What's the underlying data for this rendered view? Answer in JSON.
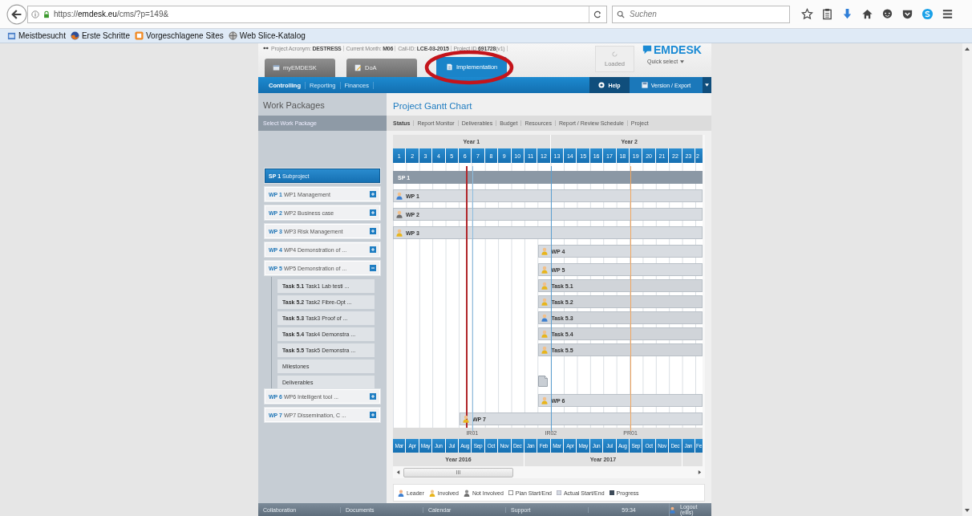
{
  "browser": {
    "url": "https://**emdesk.eu**/cms/?p=149&",
    "search": {
      "placeholder": "Suchen"
    },
    "bookmarks": [
      {
        "label": "Meistbesucht",
        "kind": "folder"
      },
      {
        "label": "Erste Schritte",
        "kind": "firefox"
      },
      {
        "label": "Vorgeschlagene Sites",
        "kind": "sites"
      },
      {
        "label": "Web Slice-Katalog",
        "kind": "globe"
      }
    ]
  },
  "header": {
    "info": [
      "Project Acronym: **DESTRESS**",
      "Current Month: **M06**",
      "Call-ID: **LCE-03-2015**",
      "Project ID **691728**(v1)"
    ],
    "tabs": [
      {
        "label": "myEMDESK",
        "selected": false,
        "kind": "home"
      },
      {
        "label": "DoA",
        "selected": false,
        "kind": "edit"
      },
      {
        "label": "Implementation",
        "selected": true,
        "kind": "doc"
      }
    ],
    "loaded": {
      "label": "Loaded",
      "disabled": true
    },
    "logo": "EMDESK",
    "quick_select": "Quick select"
  },
  "nav": {
    "items": [
      {
        "label": "Controlling",
        "selected": true
      },
      {
        "label": "Reporting",
        "selected": false
      },
      {
        "label": "Finances",
        "selected": false
      }
    ],
    "help": "Help",
    "export": "Version / Export"
  },
  "sidebar": {
    "title": "Work Packages",
    "subtitle": "Select Work Package",
    "items": [
      {
        "kind": "sp",
        "code": "SP 1",
        "title": "Subproject",
        "selected": true
      },
      {
        "kind": "wp",
        "code": "WP 1",
        "title": "WP1 Management",
        "selected": false,
        "expanded": false
      },
      {
        "kind": "wp",
        "code": "WP 2",
        "title": "WP2 Business case",
        "selected": false,
        "expanded": false
      },
      {
        "kind": "wp",
        "code": "WP 3",
        "title": "WP3 Risk Management",
        "selected": false,
        "expanded": false
      },
      {
        "kind": "wp",
        "code": "WP 4",
        "title": "WP4 Demonstration of ...",
        "selected": false,
        "expanded": false
      },
      {
        "kind": "wp",
        "code": "WP 5",
        "title": "WP5 Demonstration of ...",
        "selected": false,
        "expanded": true,
        "children": [
          {
            "code": "Task 5.1",
            "title": "Task1 Lab testi ..."
          },
          {
            "code": "Task 5.2",
            "title": "Task2 Fibre-Opt ..."
          },
          {
            "code": "Task 5.3",
            "title": "Task3 Proof of ..."
          },
          {
            "code": "Task 5.4",
            "title": "Task4 Demonstra ..."
          },
          {
            "code": "Task 5.5",
            "title": "Task5 Demonstra ..."
          },
          {
            "title": "Milestones"
          },
          {
            "title": "Deliverables"
          }
        ]
      },
      {
        "kind": "wp",
        "code": "WP 6",
        "title": "WP6 Intelligent tool ...",
        "selected": false,
        "expanded": false
      },
      {
        "kind": "wp",
        "code": "WP 7",
        "title": "WP7 Dissemination, C ...",
        "selected": false,
        "expanded": false
      }
    ]
  },
  "main": {
    "title": "Project Gantt Chart",
    "tabs": [
      {
        "label": "Status",
        "selected": true
      },
      {
        "label": "Report Monitor",
        "selected": false
      },
      {
        "label": "Deliverables",
        "selected": false
      },
      {
        "label": "Budget",
        "selected": false
      },
      {
        "label": "Resources",
        "selected": false
      },
      {
        "label": "Report / Review Schedule",
        "selected": false
      },
      {
        "label": "Project",
        "selected": false
      }
    ]
  },
  "gantt": {
    "top_years": [
      {
        "label": "Year 1",
        "months": [
          "1",
          "2",
          "3",
          "4",
          "5",
          "6",
          "7",
          "8",
          "9",
          "10",
          "11",
          "12"
        ]
      },
      {
        "label": "Year 2",
        "months": [
          "13",
          "14",
          "15",
          "16",
          "17",
          "18",
          "19",
          "20",
          "21",
          "22",
          "23",
          "2"
        ]
      }
    ],
    "rows": [
      {
        "kind": "summary",
        "label": "SP 1",
        "level": 1
      },
      {
        "kind": "wp",
        "label": "WP 1",
        "color": "#3d7fcf",
        "level": 1
      },
      {
        "kind": "wp",
        "label": "WP 2",
        "color": "#6e6e6e",
        "level": 1
      },
      {
        "kind": "wp",
        "label": "WP 3",
        "color": "#e8b51c",
        "level": 1
      },
      {
        "kind": "wp",
        "label": "WP 4",
        "color": "#e8b51c",
        "level": 0.53
      },
      {
        "kind": "wp",
        "label": "WP 5",
        "color": "#e8b51c",
        "level": 0.53
      },
      {
        "kind": "task",
        "label": "Task 5.1",
        "color": "#e8b51c",
        "level": 0.53
      },
      {
        "kind": "task",
        "label": "Task 5.2",
        "color": "#e8b51c",
        "level": 0.53
      },
      {
        "kind": "task",
        "label": "Task 5.3",
        "color": "#3d7fcf",
        "level": 0.53
      },
      {
        "kind": "task",
        "label": "Task 5.4",
        "color": "#e8b51c",
        "level": 0.53
      },
      {
        "kind": "task",
        "label": "Task 5.5",
        "color": "#e8b51c",
        "level": 0.53
      },
      {
        "kind": "deliverable",
        "level": 0.53
      },
      {
        "kind": "wp",
        "label": "WP 6",
        "color": "#e8b51c",
        "level": 0.53
      },
      {
        "kind": "wp",
        "label": "WP 7",
        "color": "#e8b51c",
        "level": 0.785
      }
    ],
    "markers": [
      {
        "kind": "today",
        "color": "#b0262b",
        "level": 0.236
      },
      {
        "kind": "milestone",
        "label": "IR01",
        "color": "#8dbde0",
        "level": 0.256
      },
      {
        "kind": "milestone",
        "label": "IR02",
        "color": "#5c9fd0",
        "level": 0.51
      },
      {
        "kind": "milestone",
        "label": "PR01",
        "color": "#f2a65e",
        "level": 0.767
      }
    ],
    "bottom_years": [
      {
        "label": "Year 2016",
        "months": [
          "Mar",
          "Apr",
          "May",
          "Jun",
          "Jul",
          "Aug",
          "Sep",
          "Oct",
          "Nov",
          "Dec"
        ]
      },
      {
        "label": "Year 2017",
        "months": [
          "Jan",
          "Feb",
          "Mar",
          "Apr",
          "May",
          "Jun",
          "Jul",
          "Aug",
          "Sep",
          "Oct",
          "Nov",
          "Dec"
        ]
      },
      {
        "months": [
          "Jan",
          "Fe"
        ]
      }
    ],
    "scroll_thumb": "III"
  },
  "legend": [
    {
      "kind": "leader",
      "label": "Leader"
    },
    {
      "kind": "involved",
      "label": "Involved"
    },
    {
      "kind": "not_involved",
      "label": "Not Involved"
    },
    {
      "kind": "plan",
      "label": "Plan Start/End"
    },
    {
      "kind": "actual",
      "label": "Actual Start/End"
    },
    {
      "kind": "progress",
      "label": "Progress"
    }
  ],
  "footer": {
    "links": [
      "Collaboration",
      "Documents",
      "Calendar",
      "Support"
    ],
    "timer": "59:34",
    "logout": "Logout (ellis)"
  }
}
